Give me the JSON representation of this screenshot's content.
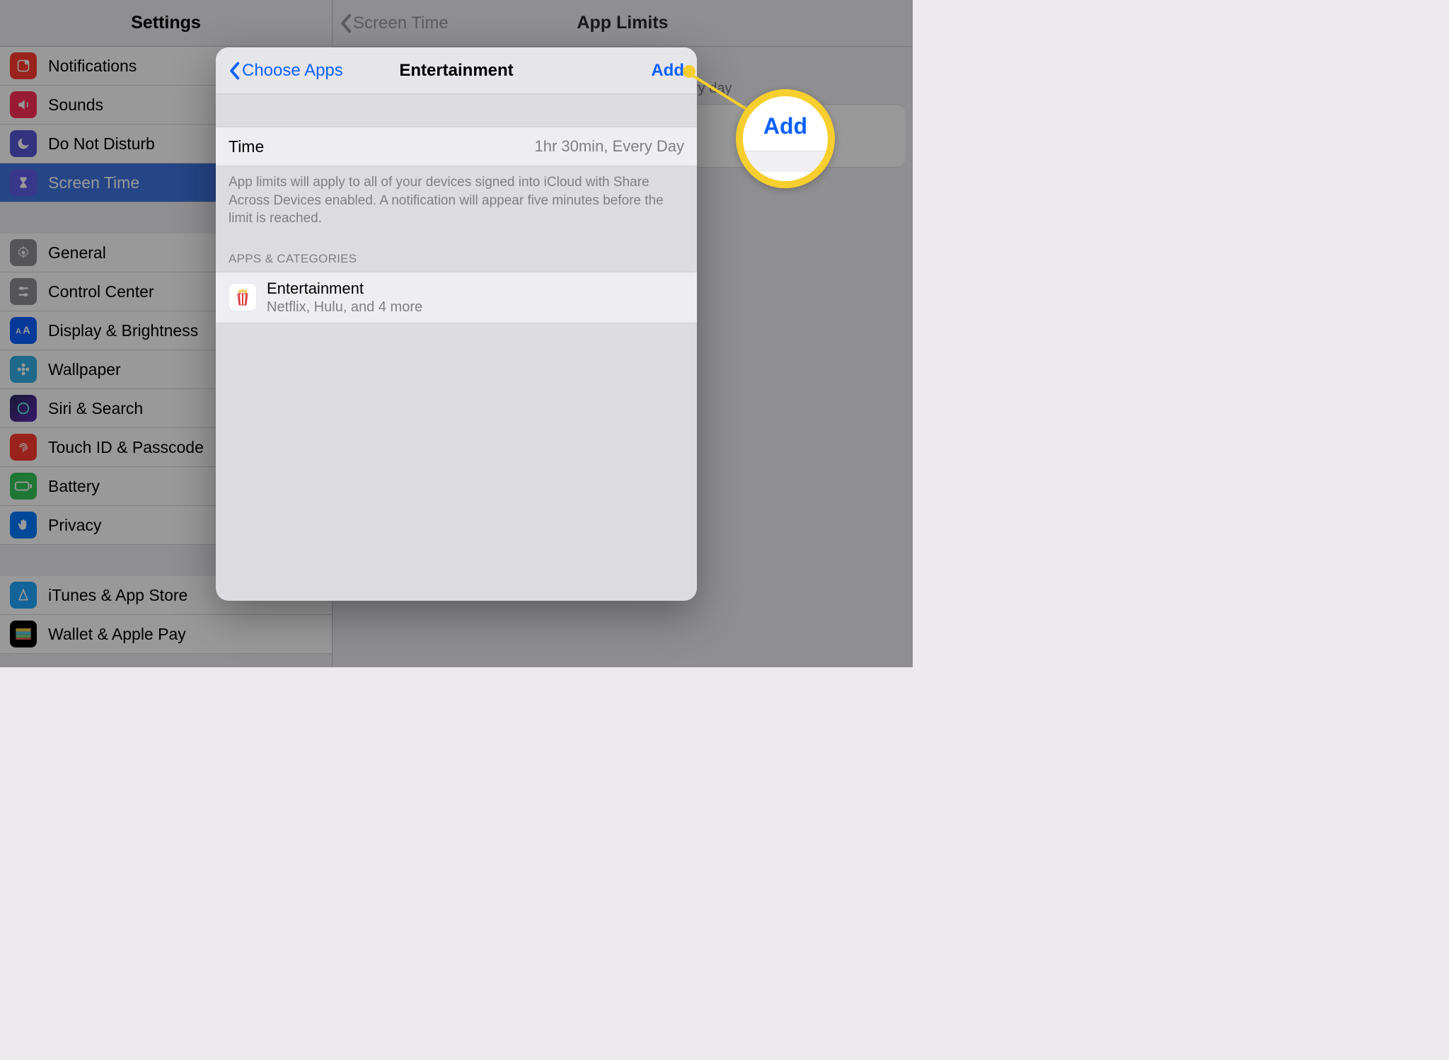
{
  "sidebar": {
    "title": "Settings",
    "groups": [
      [
        {
          "label": "Notifications",
          "color": "#ff3b30"
        },
        {
          "label": "Sounds",
          "color": "#ff2d55"
        },
        {
          "label": "Do Not Disturb",
          "color": "#5856d6"
        },
        {
          "label": "Screen Time",
          "color": "#5e5ce6",
          "selected": true
        }
      ],
      [
        {
          "label": "General",
          "color": "#8e8e93"
        },
        {
          "label": "Control Center",
          "color": "#8e8e93"
        },
        {
          "label": "Display & Brightness",
          "color": "#0a60ff"
        },
        {
          "label": "Wallpaper",
          "color": "#32ade6"
        },
        {
          "label": "Siri & Search",
          "color": "#000"
        },
        {
          "label": "Touch ID & Passcode",
          "color": "#ff3b30"
        },
        {
          "label": "Battery",
          "color": "#34c759"
        },
        {
          "label": "Privacy",
          "color": "#007aff"
        }
      ],
      [
        {
          "label": "iTunes & App Store",
          "color": "#1fa7ff"
        },
        {
          "label": "Wallet & Apple Pay",
          "color": "#000"
        }
      ]
    ]
  },
  "detail": {
    "back_label": "Screen Time",
    "title": "App Limits",
    "note_suffix": "pp limits reset every day"
  },
  "modal": {
    "back_label": "Choose Apps",
    "title": "Entertainment",
    "add_label": "Add",
    "time_row": {
      "label": "Time",
      "value": "1hr 30min, Every Day"
    },
    "time_footer": "App limits will apply to all of your devices signed into iCloud with Share Across Devices enabled. A notification will appear five minutes before the limit is reached.",
    "apps_header": "APPS & CATEGORIES",
    "app_row": {
      "name": "Entertainment",
      "subtitle": "Netflix, Hulu, and 4 more"
    }
  },
  "callout": {
    "label": "Add"
  }
}
